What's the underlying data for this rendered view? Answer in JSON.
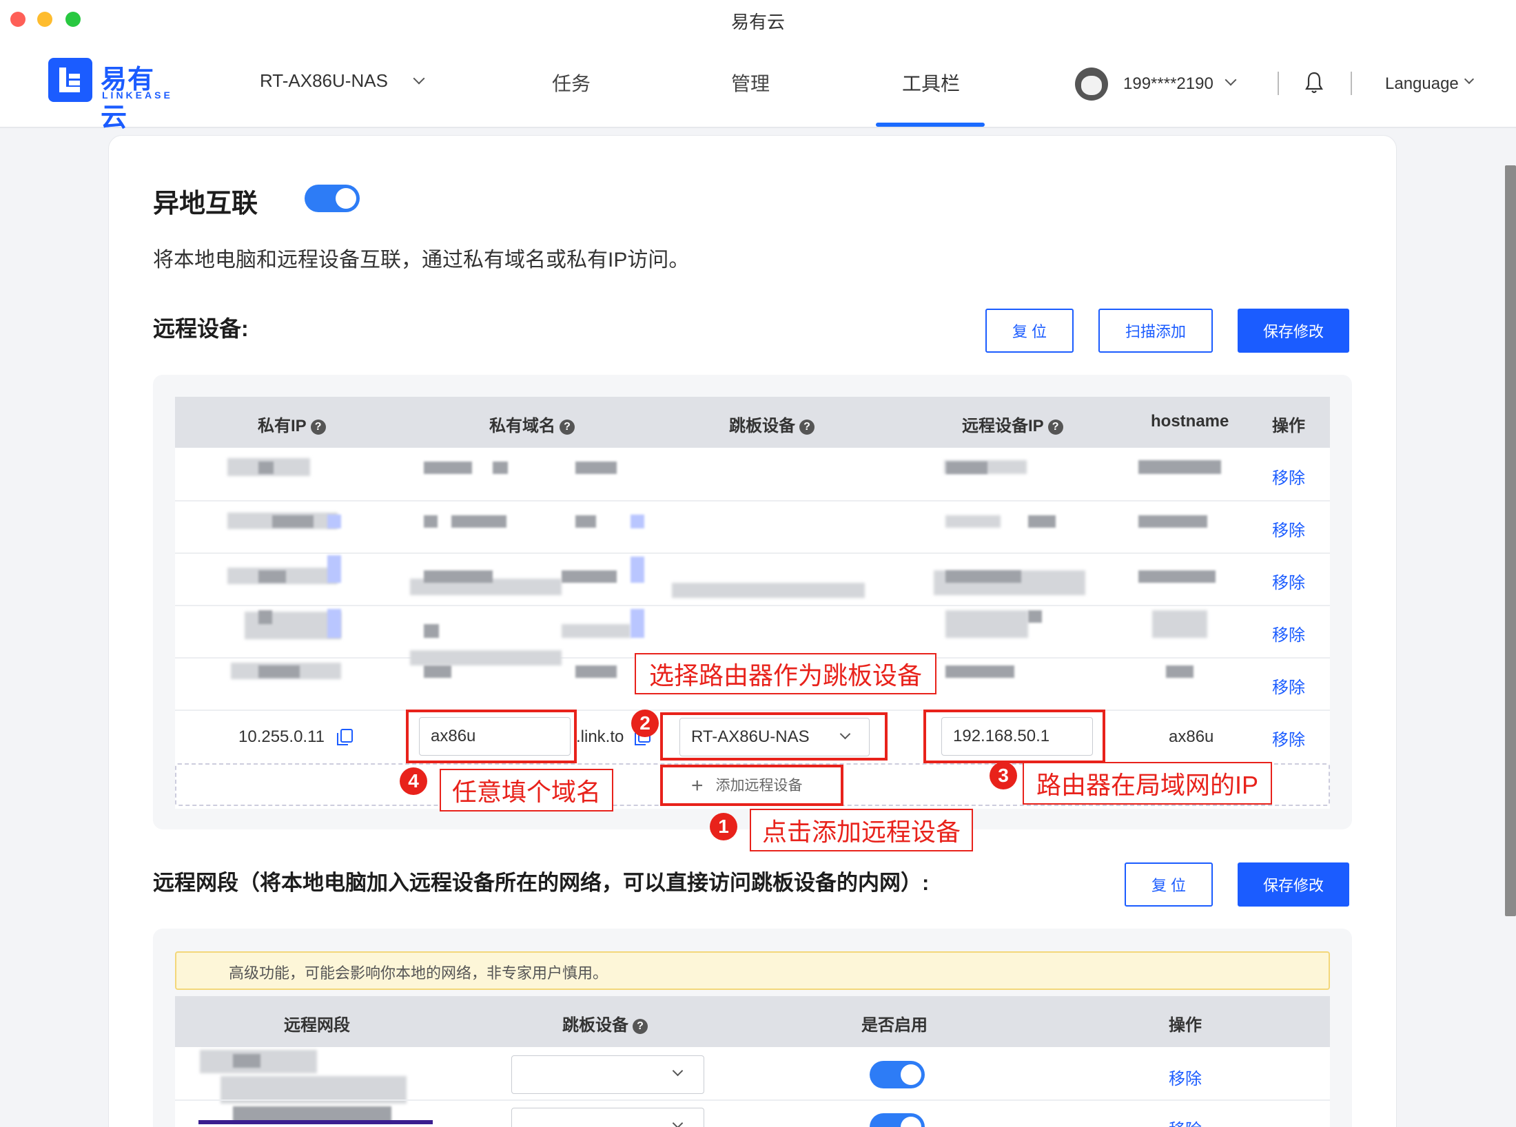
{
  "window": {
    "title": "易有云"
  },
  "brand": {
    "cn": "易有云",
    "en": "LINKEASE",
    "color": "#1b5cff"
  },
  "nav": {
    "device": "RT-AX86U-NAS",
    "items": [
      "任务",
      "管理",
      "工具栏"
    ],
    "active": "工具栏",
    "user": "199****2190",
    "language": "Language"
  },
  "section": {
    "title": "异地互联",
    "enabled": true,
    "description": "将本地电脑和远程设备互联，通过私有域名或私有IP访问。"
  },
  "remote_devices": {
    "title": "远程设备:",
    "buttons": {
      "reset": "复 位",
      "scan": "扫描添加",
      "save": "保存修改"
    },
    "columns": [
      "私有IP",
      "私有域名",
      "跳板设备",
      "远程设备IP",
      "hostname",
      "操作"
    ],
    "remove_label": "移除",
    "hidden_rows": 5,
    "edit_row": {
      "private_ip": "10.255.0.11",
      "domain": "ax86u",
      "domain_suffix": ".link.to",
      "jump_device": "RT-AX86U-NAS",
      "remote_ip": "192.168.50.1",
      "hostname": "ax86u"
    },
    "add_label": "添加远程设备"
  },
  "annotations": [
    {
      "num": "1",
      "text": "点击添加远程设备"
    },
    {
      "num": "2",
      "text": "选择路由器作为跳板设备"
    },
    {
      "num": "3",
      "text": "路由器在局域网的IP"
    },
    {
      "num": "4",
      "text": "任意填个域名"
    }
  ],
  "remote_segments": {
    "title": "远程网段（将本地电脑加入远程设备所在的网络，可以直接访问跳板设备的内网）:",
    "buttons": {
      "reset": "复 位",
      "save": "保存修改"
    },
    "warning": "高级功能，可能会影响你本地的网络，非专家用户慎用。",
    "columns": [
      "远程网段",
      "跳板设备",
      "是否启用",
      "操作"
    ],
    "remove_label": "移除",
    "rows": [
      {
        "enabled": true
      },
      {
        "enabled": true
      }
    ]
  }
}
